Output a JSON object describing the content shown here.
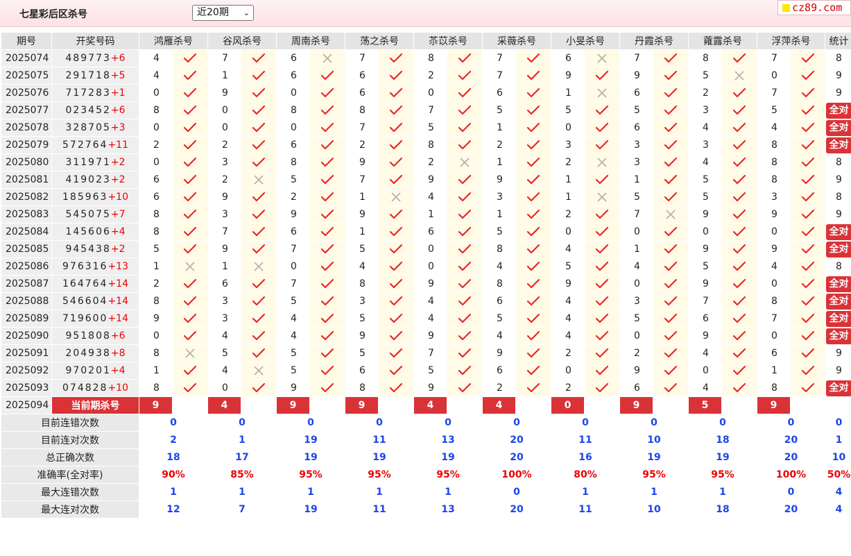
{
  "header": {
    "title": "七星彩后区杀号",
    "period_select": "近20期",
    "logo_text": "cz89.com"
  },
  "columns": {
    "issue": "期号",
    "draw": "开奖号码",
    "experts": [
      "鸿雁杀号",
      "谷风杀号",
      "周南杀号",
      "荡之杀号",
      "苶苡杀号",
      "采薇杀号",
      "小旻杀号",
      "丹霞杀号",
      "蕹露杀号",
      "浮萍杀号"
    ],
    "stat": "统计"
  },
  "rows": [
    {
      "issue": "2025074",
      "draw_main": "489773",
      "draw_special": "+6",
      "kills": [
        4,
        7,
        6,
        7,
        8,
        7,
        6,
        7,
        8,
        7
      ],
      "ok": [
        1,
        1,
        0,
        1,
        1,
        1,
        0,
        1,
        1,
        1
      ],
      "stat": "8"
    },
    {
      "issue": "2025075",
      "draw_main": "291718",
      "draw_special": "+5",
      "kills": [
        4,
        1,
        6,
        6,
        2,
        7,
        9,
        9,
        5,
        0
      ],
      "ok": [
        1,
        1,
        1,
        1,
        1,
        1,
        1,
        1,
        0,
        1
      ],
      "stat": "9"
    },
    {
      "issue": "2025076",
      "draw_main": "717283",
      "draw_special": "+1",
      "kills": [
        0,
        9,
        0,
        6,
        0,
        6,
        1,
        6,
        2,
        7
      ],
      "ok": [
        1,
        1,
        1,
        1,
        1,
        1,
        0,
        1,
        1,
        1
      ],
      "stat": "9"
    },
    {
      "issue": "2025077",
      "draw_main": "023452",
      "draw_special": "+6",
      "kills": [
        8,
        0,
        8,
        8,
        7,
        5,
        5,
        5,
        3,
        5
      ],
      "ok": [
        1,
        1,
        1,
        1,
        1,
        1,
        1,
        1,
        1,
        1
      ],
      "stat": "全对"
    },
    {
      "issue": "2025078",
      "draw_main": "328705",
      "draw_special": "+3",
      "kills": [
        0,
        0,
        0,
        7,
        5,
        1,
        0,
        6,
        4,
        4
      ],
      "ok": [
        1,
        1,
        1,
        1,
        1,
        1,
        1,
        1,
        1,
        1
      ],
      "stat": "全对"
    },
    {
      "issue": "2025079",
      "draw_main": "572764",
      "draw_special": "+11",
      "kills": [
        2,
        2,
        6,
        2,
        8,
        2,
        3,
        3,
        3,
        8
      ],
      "ok": [
        1,
        1,
        1,
        1,
        1,
        1,
        1,
        1,
        1,
        1
      ],
      "stat": "全对"
    },
    {
      "issue": "2025080",
      "draw_main": "311971",
      "draw_special": "+2",
      "kills": [
        0,
        3,
        8,
        9,
        2,
        1,
        2,
        3,
        4,
        8
      ],
      "ok": [
        1,
        1,
        1,
        1,
        0,
        1,
        0,
        1,
        1,
        1
      ],
      "stat": "8"
    },
    {
      "issue": "2025081",
      "draw_main": "419023",
      "draw_special": "+2",
      "kills": [
        6,
        2,
        5,
        7,
        9,
        9,
        1,
        1,
        5,
        8
      ],
      "ok": [
        1,
        0,
        1,
        1,
        1,
        1,
        1,
        1,
        1,
        1
      ],
      "stat": "9"
    },
    {
      "issue": "2025082",
      "draw_main": "185963",
      "draw_special": "+10",
      "kills": [
        6,
        9,
        2,
        1,
        4,
        3,
        1,
        5,
        5,
        3
      ],
      "ok": [
        1,
        1,
        1,
        0,
        1,
        1,
        0,
        1,
        1,
        1
      ],
      "stat": "8"
    },
    {
      "issue": "2025083",
      "draw_main": "545075",
      "draw_special": "+7",
      "kills": [
        8,
        3,
        9,
        9,
        1,
        1,
        2,
        7,
        9,
        9
      ],
      "ok": [
        1,
        1,
        1,
        1,
        1,
        1,
        1,
        0,
        1,
        1
      ],
      "stat": "9"
    },
    {
      "issue": "2025084",
      "draw_main": "145606",
      "draw_special": "+4",
      "kills": [
        8,
        7,
        6,
        1,
        6,
        5,
        0,
        0,
        0,
        0
      ],
      "ok": [
        1,
        1,
        1,
        1,
        1,
        1,
        1,
        1,
        1,
        1
      ],
      "stat": "全对"
    },
    {
      "issue": "2025085",
      "draw_main": "945438",
      "draw_special": "+2",
      "kills": [
        5,
        9,
        7,
        5,
        0,
        8,
        4,
        1,
        9,
        9
      ],
      "ok": [
        1,
        1,
        1,
        1,
        1,
        1,
        1,
        1,
        1,
        1
      ],
      "stat": "全对"
    },
    {
      "issue": "2025086",
      "draw_main": "976316",
      "draw_special": "+13",
      "kills": [
        1,
        1,
        0,
        4,
        0,
        4,
        5,
        4,
        5,
        4
      ],
      "ok": [
        0,
        0,
        1,
        1,
        1,
        1,
        1,
        1,
        1,
        1
      ],
      "stat": "8"
    },
    {
      "issue": "2025087",
      "draw_main": "164764",
      "draw_special": "+14",
      "kills": [
        2,
        6,
        7,
        8,
        9,
        8,
        9,
        0,
        9,
        0
      ],
      "ok": [
        1,
        1,
        1,
        1,
        1,
        1,
        1,
        1,
        1,
        1
      ],
      "stat": "全对"
    },
    {
      "issue": "2025088",
      "draw_main": "546604",
      "draw_special": "+14",
      "kills": [
        8,
        3,
        5,
        3,
        4,
        6,
        4,
        3,
        7,
        8
      ],
      "ok": [
        1,
        1,
        1,
        1,
        1,
        1,
        1,
        1,
        1,
        1
      ],
      "stat": "全对"
    },
    {
      "issue": "2025089",
      "draw_main": "719600",
      "draw_special": "+14",
      "kills": [
        9,
        3,
        4,
        5,
        4,
        5,
        4,
        5,
        6,
        7
      ],
      "ok": [
        1,
        1,
        1,
        1,
        1,
        1,
        1,
        1,
        1,
        1
      ],
      "stat": "全对"
    },
    {
      "issue": "2025090",
      "draw_main": "951808",
      "draw_special": "+6",
      "kills": [
        0,
        4,
        4,
        9,
        9,
        4,
        4,
        0,
        9,
        0
      ],
      "ok": [
        1,
        1,
        1,
        1,
        1,
        1,
        1,
        1,
        1,
        1
      ],
      "stat": "全对"
    },
    {
      "issue": "2025091",
      "draw_main": "204938",
      "draw_special": "+8",
      "kills": [
        8,
        5,
        5,
        5,
        7,
        9,
        2,
        2,
        4,
        6
      ],
      "ok": [
        0,
        1,
        1,
        1,
        1,
        1,
        1,
        1,
        1,
        1
      ],
      "stat": "9"
    },
    {
      "issue": "2025092",
      "draw_main": "970201",
      "draw_special": "+4",
      "kills": [
        1,
        4,
        5,
        6,
        5,
        6,
        0,
        9,
        0,
        1
      ],
      "ok": [
        1,
        0,
        1,
        1,
        1,
        1,
        1,
        1,
        1,
        1
      ],
      "stat": "9"
    },
    {
      "issue": "2025093",
      "draw_main": "074828",
      "draw_special": "+10",
      "kills": [
        8,
        0,
        9,
        8,
        9,
        2,
        2,
        6,
        4,
        8
      ],
      "ok": [
        1,
        1,
        1,
        1,
        1,
        1,
        1,
        1,
        1,
        1
      ],
      "stat": "全对"
    }
  ],
  "current": {
    "issue": "2025094",
    "label": "当前期杀号",
    "kills": [
      "9",
      "4",
      "9",
      "9",
      "4",
      "4",
      "0",
      "9",
      "5",
      "9"
    ]
  },
  "summary": [
    {
      "label": "目前连错次数",
      "values": [
        "0",
        "0",
        "0",
        "0",
        "0",
        "0",
        "0",
        "0",
        "0",
        "0"
      ],
      "stat": "0",
      "red": false
    },
    {
      "label": "目前连对次数",
      "values": [
        "2",
        "1",
        "19",
        "11",
        "13",
        "20",
        "11",
        "10",
        "18",
        "20"
      ],
      "stat": "1",
      "red": false
    },
    {
      "label": "总正确次数",
      "values": [
        "18",
        "17",
        "19",
        "19",
        "19",
        "20",
        "16",
        "19",
        "19",
        "20"
      ],
      "stat": "10",
      "red": false
    },
    {
      "label": "准确率(全对率)",
      "values": [
        "90%",
        "85%",
        "95%",
        "95%",
        "95%",
        "100%",
        "80%",
        "95%",
        "95%",
        "100%"
      ],
      "stat": "50%",
      "red": true
    },
    {
      "label": "最大连错次数",
      "values": [
        "1",
        "1",
        "1",
        "1",
        "1",
        "0",
        "1",
        "1",
        "1",
        "0"
      ],
      "stat": "4",
      "red": false
    },
    {
      "label": "最大连对次数",
      "values": [
        "12",
        "7",
        "19",
        "11",
        "13",
        "20",
        "11",
        "10",
        "18",
        "20"
      ],
      "stat": "4",
      "red": false
    }
  ],
  "colors": {
    "accent_red": "#d93338",
    "check_red": "#e8262b",
    "cross_gray": "#b0b0b0",
    "stat_blue": "#1c46e8"
  },
  "icons": {
    "correct": "check-icon",
    "wrong": "cross-icon",
    "dropdown": "chevron-down-icon",
    "logo": "yellow-square-icon"
  }
}
